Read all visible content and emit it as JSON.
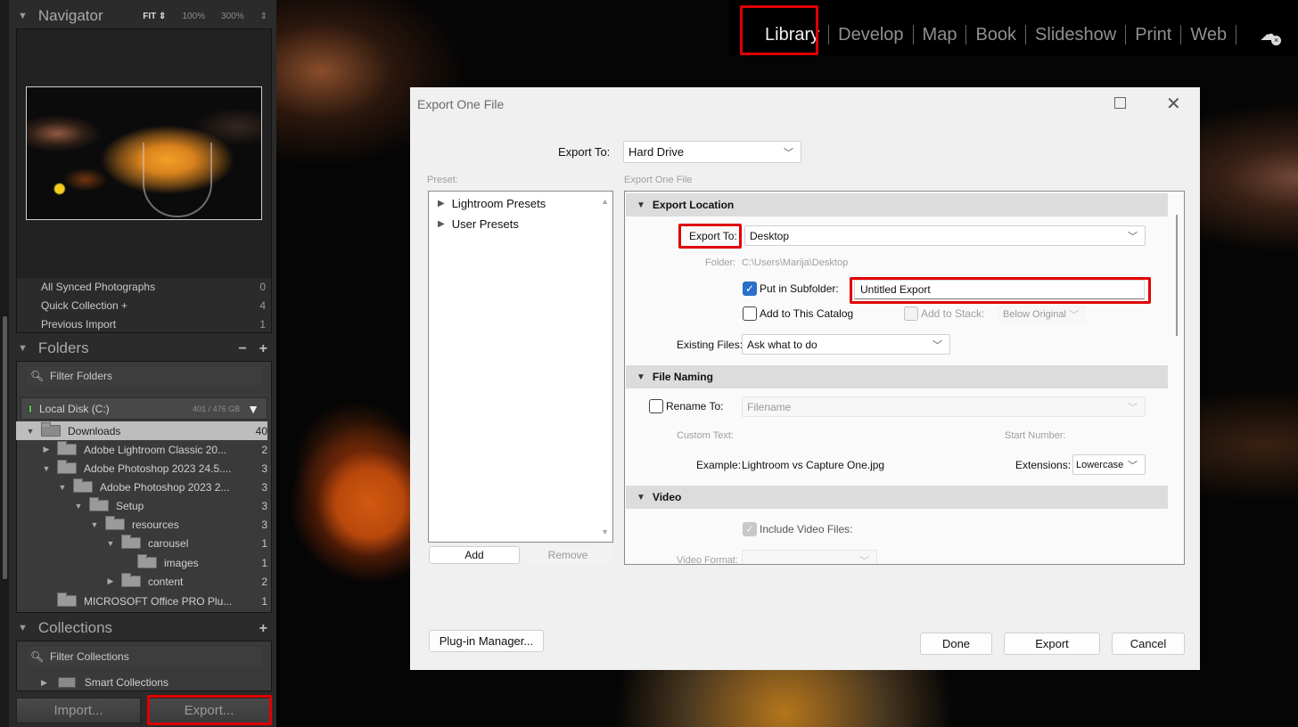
{
  "module_bar": {
    "modules": [
      "Library",
      "Develop",
      "Map",
      "Book",
      "Slideshow",
      "Print",
      "Web"
    ],
    "active": "Library",
    "cloud_icon": "cloud-sync-icon"
  },
  "left_panel": {
    "navigator": {
      "title": "Navigator",
      "zoom_options": [
        "FIT",
        "100%",
        "300%"
      ],
      "zoom_selected": "FIT"
    },
    "catalog": {
      "items": [
        {
          "label": "All Synced Photographs",
          "count": "0"
        },
        {
          "label": "Quick Collection +",
          "count": "4"
        },
        {
          "label": "Previous Import",
          "count": "1"
        }
      ]
    },
    "folders": {
      "title": "Folders",
      "minus": "−",
      "plus": "+",
      "filter_placeholder": "Filter Folders",
      "disk": {
        "name": "Local Disk (C:)",
        "size": "401 / 476 GB"
      },
      "tree": [
        {
          "name": "Downloads",
          "count": "40",
          "expanded": true,
          "selected": true
        },
        {
          "name": "Adobe Lightroom Classic 20...",
          "count": "2",
          "expanded": false
        },
        {
          "name": "Adobe Photoshop 2023 24.5....",
          "count": "3",
          "expanded": true
        },
        {
          "name": "Adobe Photoshop 2023 2...",
          "count": "3",
          "expanded": true
        },
        {
          "name": "Setup",
          "count": "3",
          "expanded": true
        },
        {
          "name": "resources",
          "count": "3",
          "expanded": true
        },
        {
          "name": "carousel",
          "count": "1",
          "expanded": true
        },
        {
          "name": "images",
          "count": "1",
          "expanded": null
        },
        {
          "name": "content",
          "count": "2",
          "expanded": false
        },
        {
          "name": "MICROSOFT Office PRO Plu...",
          "count": "1",
          "expanded": null
        }
      ]
    },
    "collections": {
      "title": "Collections",
      "plus": "+",
      "filter_placeholder": "Filter Collections",
      "items": [
        {
          "label": "Smart Collections"
        }
      ]
    },
    "import_button": "Import...",
    "export_button": "Export..."
  },
  "dialog": {
    "title": "Export One File",
    "export_to_label": "Export To:",
    "export_to_value": "Hard Drive",
    "preset_label": "Preset:",
    "settings_label": "Export One File",
    "presets": [
      "Lightroom Presets",
      "User Presets"
    ],
    "add_button": "Add",
    "remove_button": "Remove",
    "sections": {
      "export_location": {
        "title": "Export Location",
        "export_to_label": "Export To:",
        "export_to_value": "Desktop",
        "folder_label": "Folder:",
        "folder_value": "C:\\Users\\Marija\\Desktop",
        "subfolder_label": "Put in Subfolder:",
        "subfolder_checked": true,
        "subfolder_value": "Untitled Export",
        "add_catalog_label": "Add to This Catalog",
        "add_catalog_checked": false,
        "add_stack_label": "Add to Stack:",
        "add_stack_value": "Below Original",
        "existing_files_label": "Existing Files:",
        "existing_files_value": "Ask what to do"
      },
      "file_naming": {
        "title": "File Naming",
        "rename_label": "Rename To:",
        "rename_checked": false,
        "rename_value": "Filename",
        "custom_text_label": "Custom Text:",
        "start_number_label": "Start Number:",
        "example_label": "Example:",
        "example_value": "Lightroom vs Capture One.jpg",
        "extensions_label": "Extensions:",
        "extensions_value": "Lowercase"
      },
      "video": {
        "title": "Video",
        "include_video_label": "Include Video Files:",
        "include_video_checked": true,
        "video_format_label": "Video Format:"
      }
    },
    "plugin_manager_button": "Plug-in Manager...",
    "done_button": "Done",
    "export_button": "Export",
    "cancel_button": "Cancel"
  },
  "highlight_color": "#e00000",
  "accent_color": "#2a6fc9"
}
